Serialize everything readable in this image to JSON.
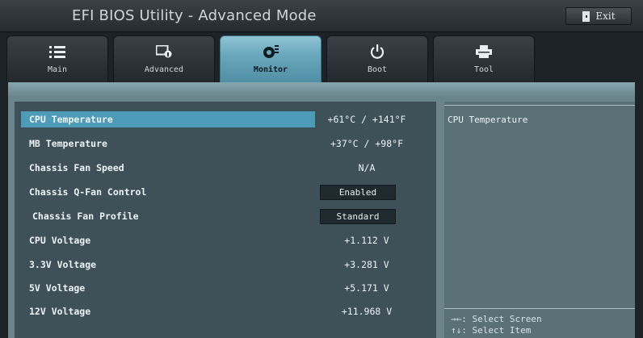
{
  "window": {
    "title": "EFI BIOS Utility - Advanced Mode",
    "exit_label": "Exit"
  },
  "tabs": [
    {
      "label": "Main",
      "icon": "list-icon"
    },
    {
      "label": "Advanced",
      "icon": "advanced-icon"
    },
    {
      "label": "Monitor",
      "icon": "monitor-icon"
    },
    {
      "label": "Boot",
      "icon": "power-icon"
    },
    {
      "label": "Tool",
      "icon": "printer-icon"
    }
  ],
  "active_tab": "Monitor",
  "items": [
    {
      "label": "CPU Temperature",
      "value": "+61°C / +141°F"
    },
    {
      "label": "MB Temperature",
      "value": "+37°C / +98°F"
    },
    {
      "label": "Chassis Fan Speed",
      "value": "N/A"
    },
    {
      "label": "Chassis Q-Fan Control",
      "value": "Enabled"
    },
    {
      "label": "Chassis Fan Profile",
      "value": "Standard"
    },
    {
      "label": "CPU Voltage",
      "value": "+1.112 V"
    },
    {
      "label": "3.3V Voltage",
      "value": "+3.281 V"
    },
    {
      "label": "5V Voltage",
      "value": "+5.171 V"
    },
    {
      "label": "12V Voltage",
      "value": "+11.968 V"
    }
  ],
  "help": {
    "title": "CPU Temperature",
    "hints": [
      "→←: Select Screen",
      "↑↓: Select Item"
    ]
  },
  "colors": {
    "accent": "#4d9cb7",
    "panel": "#3e5158",
    "button": "#1f2a2f"
  }
}
